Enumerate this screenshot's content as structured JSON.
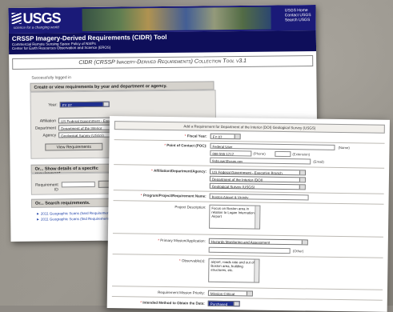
{
  "back_window": {
    "logo": "USGS",
    "tagline": "science for a changing world",
    "links": [
      "USGS Home",
      "Contact USGS",
      "Search USGS"
    ],
    "title": "CRSSP Imagery-Derived Requirements (CIDR) Tool",
    "subtitle_1": "Commercial Remote Sensing Space Policy of NSIPs",
    "subtitle_2": "Center for Earth Resources Observation and Science (EROS)",
    "collection_title": "CIDR (CRSSP Imagery-Derived Requirements) Collection Tool v3.1",
    "logged_in": "Successfully logged in",
    "section1_head": "Create or view requirements by year and department or agency.",
    "year_label": "Year:",
    "year_value": "FY 07",
    "affiliation_label": "Affiliation",
    "affiliation_value": "US Federal Government - Executive Branch",
    "department_label": "Department",
    "department_value": "Department of the Interior",
    "agency_label": "Agency",
    "agency_value": "Geological Survey (USGS)",
    "view_button": "View Requirements",
    "section2_head": "Or... Show details of a specific requirement",
    "requirement_label": "Requirement ID",
    "section3_head": "Or... Search requirements.",
    "link1": "► 2011 Geographic Scans (hard Requirements)",
    "link2": "► 2011 Geographic Scans (find Requirements)"
  },
  "front_window": {
    "form_title": "Add a Requirement for Department of the Interior (DOI) Geological Survey (USGS)",
    "fiscal_year_label": "Fiscal Year:",
    "fiscal_year_value": "FY 07",
    "poc_label": "Point of Contact (POC):",
    "poc_name": "Federal User",
    "poc_name_hint": "(Name)",
    "poc_phone": "888-555-1212",
    "poc_phone_hint": "(Phone)",
    "poc_ext_hint": "(Extension)",
    "poc_email": "fedsuser@usgs.gov",
    "poc_email_hint": "(Email)",
    "affiliation_label": "Affiliation/Department/Agency:",
    "affiliation_value": "US Federal Government - Executive Branch",
    "department_value": "Department of the Interior (DOI)",
    "agency_value": "Geological Survey (USGS)",
    "program_label": "Program/Project/Requirement Name:",
    "program_value": "Boston Airport & Vicinity",
    "project_desc_label": "Project Description:",
    "project_desc_value": "Focus on Boston area in relation to Logan International Airport",
    "mission_label": "Primary Mission/Application:",
    "mission_value": "Hazards Monitoring and Assessment",
    "mission_other_hint": "(Other)",
    "observables_label": "Observable(s):",
    "observables_value": "airport, roads rate and out of Boston area, building structures, etc.",
    "priority_label": "Requirement Mission Priority:",
    "priority_value": "Mission Critical",
    "intended_label": "Intended Method to Obtain the Data:",
    "intended_value": "Purchased"
  }
}
